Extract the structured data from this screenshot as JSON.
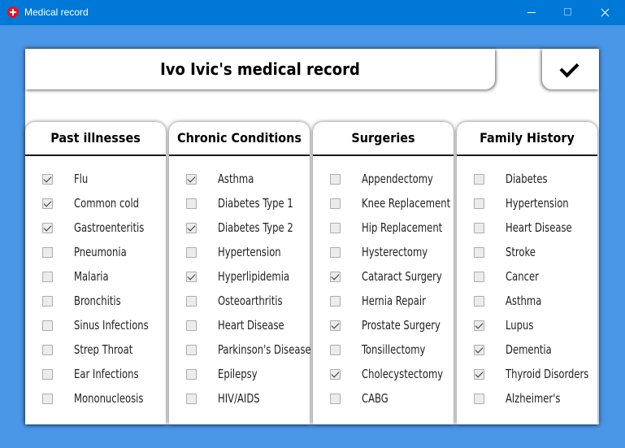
{
  "window": {
    "title": "Medical record"
  },
  "header": {
    "title": "Ivo Ivic's medical record"
  },
  "columns": [
    {
      "title": "Past illnesses",
      "items": [
        {
          "label": "Flu",
          "checked": true
        },
        {
          "label": "Common cold",
          "checked": true
        },
        {
          "label": "Gastroenteritis",
          "checked": true
        },
        {
          "label": "Pneumonia",
          "checked": false
        },
        {
          "label": "Malaria",
          "checked": false
        },
        {
          "label": "Bronchitis",
          "checked": false
        },
        {
          "label": "Sinus Infections",
          "checked": false
        },
        {
          "label": "Strep Throat",
          "checked": false
        },
        {
          "label": "Ear Infections",
          "checked": false
        },
        {
          "label": "Mononucleosis",
          "checked": false
        }
      ]
    },
    {
      "title": "Chronic Conditions",
      "items": [
        {
          "label": "Asthma",
          "checked": true
        },
        {
          "label": "Diabetes Type 1",
          "checked": false
        },
        {
          "label": "Diabetes Type 2",
          "checked": true
        },
        {
          "label": "Hypertension",
          "checked": false
        },
        {
          "label": "Hyperlipidemia",
          "checked": true
        },
        {
          "label": "Osteoarthritis",
          "checked": false
        },
        {
          "label": "Heart Disease",
          "checked": false
        },
        {
          "label": "Parkinson's Disease",
          "checked": false
        },
        {
          "label": "Epilepsy",
          "checked": false
        },
        {
          "label": "HIV/AIDS",
          "checked": false
        }
      ]
    },
    {
      "title": "Surgeries",
      "items": [
        {
          "label": "Appendectomy",
          "checked": false
        },
        {
          "label": "Knee Replacement",
          "checked": false
        },
        {
          "label": "Hip Replacement",
          "checked": false
        },
        {
          "label": "Hysterectomy",
          "checked": false
        },
        {
          "label": "Cataract Surgery",
          "checked": true
        },
        {
          "label": "Hernia Repair",
          "checked": false
        },
        {
          "label": "Prostate Surgery",
          "checked": true
        },
        {
          "label": "Tonsillectomy",
          "checked": false
        },
        {
          "label": "Cholecystectomy",
          "checked": true
        },
        {
          "label": "CABG",
          "checked": false
        }
      ]
    },
    {
      "title": "Family History",
      "items": [
        {
          "label": "Diabetes",
          "checked": false
        },
        {
          "label": "Hypertension",
          "checked": false
        },
        {
          "label": "Heart Disease",
          "checked": false
        },
        {
          "label": "Stroke",
          "checked": false
        },
        {
          "label": "Cancer",
          "checked": false
        },
        {
          "label": "Asthma",
          "checked": false
        },
        {
          "label": "Lupus",
          "checked": true
        },
        {
          "label": "Dementia",
          "checked": true
        },
        {
          "label": "Thyroid Disorders",
          "checked": true
        },
        {
          "label": "Alzheimer's",
          "checked": false
        }
      ]
    }
  ]
}
